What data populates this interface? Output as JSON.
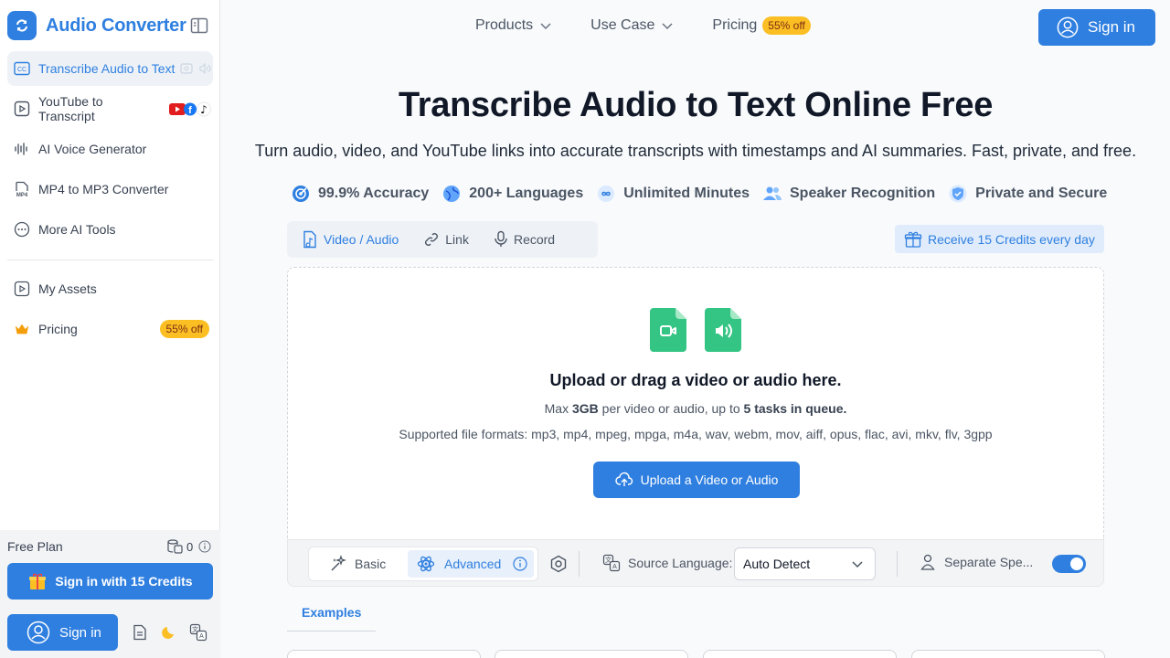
{
  "sidebar": {
    "brand": "Audio Converter",
    "items": [
      {
        "label": "Transcribe Audio to Text",
        "icon": "closed-caption-icon",
        "active": true
      },
      {
        "label": "YouTube to Transcript",
        "icon": "play-square-icon"
      },
      {
        "label": "AI Voice Generator",
        "icon": "waveform-icon"
      },
      {
        "label": "MP4 to MP3 Converter",
        "icon": "mp4-file-icon"
      },
      {
        "label": "More AI Tools",
        "icon": "more-dots-icon"
      },
      {
        "label": "My Assets",
        "icon": "assets-icon"
      },
      {
        "label": "Pricing",
        "icon": "crown-icon",
        "badge": "55% off"
      }
    ],
    "free_plan": "Free Plan",
    "credits": "0",
    "signin_credits": "Sign in with 15 Credits",
    "signin": "Sign in"
  },
  "header": {
    "nav": [
      {
        "label": "Products"
      },
      {
        "label": "Use Case"
      },
      {
        "label": "Pricing",
        "badge": "55% off"
      }
    ],
    "signin": "Sign in"
  },
  "hero": {
    "title": "Transcribe Audio to Text Online Free",
    "subtitle": "Turn audio, video, and YouTube links into accurate transcripts with timestamps and AI summaries. Fast, private, and free.",
    "features": [
      {
        "label": "99.9% Accuracy",
        "icon": "target-icon"
      },
      {
        "label": "200+ Languages",
        "icon": "globe-icon"
      },
      {
        "label": "Unlimited Minutes",
        "icon": "infinity-icon"
      },
      {
        "label": "Speaker Recognition",
        "icon": "users-icon"
      },
      {
        "label": "Private and Secure",
        "icon": "shield-icon"
      }
    ]
  },
  "tabs": [
    {
      "label": "Video / Audio",
      "active": true
    },
    {
      "label": "Link"
    },
    {
      "label": "Record"
    }
  ],
  "daily_credits": "Receive 15 Credits every day",
  "upload": {
    "title": "Upload or drag a video or audio here.",
    "limit_pre": "Max ",
    "limit_size": "3GB",
    "limit_mid": " per video or audio, up to ",
    "limit_tasks": "5 tasks in queue.",
    "formats": "Supported file formats: mp3, mp4, mpeg, mpga, m4a, wav, webm, mov, aiff, opus, flac, avi, mkv, flv, 3gpp",
    "button": "Upload a Video or Audio"
  },
  "options": {
    "basic": "Basic",
    "advanced": "Advanced",
    "source_language_label": "Source Language:",
    "source_language_value": "Auto Detect",
    "separate_speakers": "Separate Spe...",
    "separate_speakers_on": true
  },
  "examples": {
    "tab": "Examples"
  },
  "colors": {
    "accent": "#2f7fe0",
    "badge": "#fbbf24",
    "green": "#34c484"
  }
}
